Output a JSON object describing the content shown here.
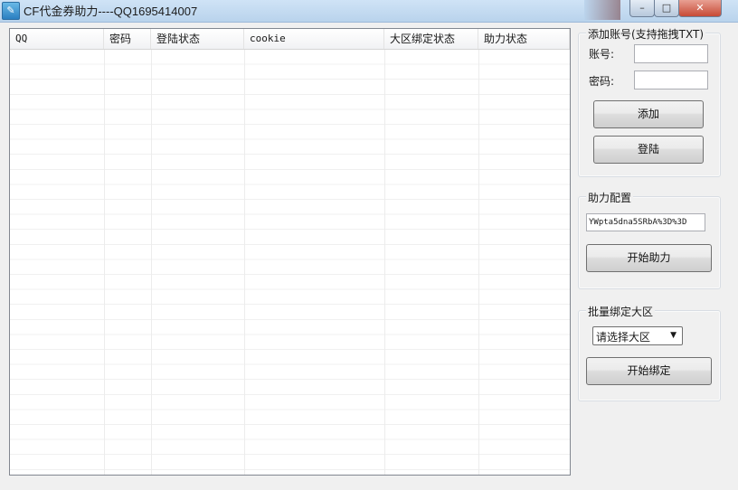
{
  "window": {
    "title": "CF代金券助力----QQ1695414007",
    "icon": "app-icon",
    "controls": {
      "minimize": "–",
      "maximize": "□",
      "close": "✕"
    }
  },
  "listview": {
    "columns": [
      "QQ",
      "密码",
      "登陆状态",
      "cookie",
      "大区绑定状态",
      "助力状态"
    ]
  },
  "add_account": {
    "title": "添加账号(支持拖拽TXT)",
    "account_label": "账号:",
    "password_label": "密码:",
    "account_value": "",
    "password_value": "",
    "add_button": "添加",
    "login_button": "登陆"
  },
  "help_config": {
    "title": "助力配置",
    "cookie_value": "YWpta5dna5SRbA%3D%3D",
    "start_button": "开始助力"
  },
  "batch_bind": {
    "title": "批量绑定大区",
    "select_value": "请选择大区",
    "start_button": "开始绑定"
  }
}
